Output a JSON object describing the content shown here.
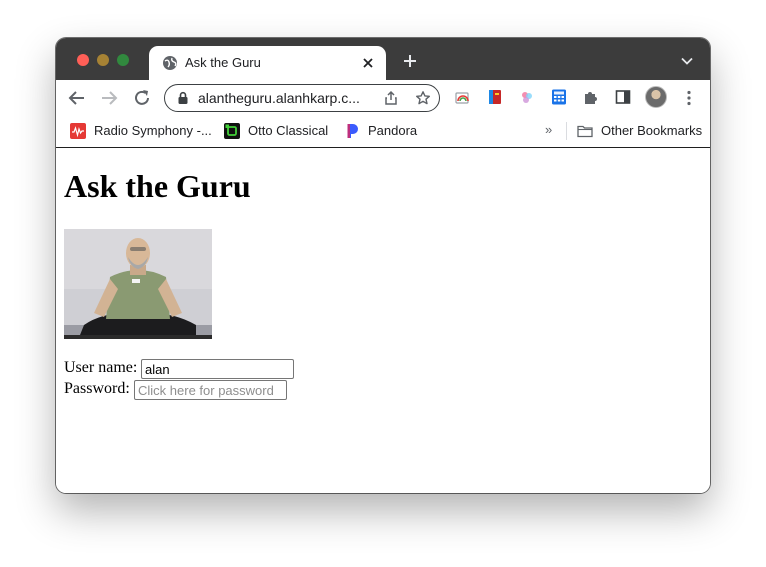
{
  "browser": {
    "tab": {
      "title": "Ask the Guru"
    },
    "address_bar": {
      "url": "alantheguru.alanhkarp.c..."
    },
    "bookmarks": [
      {
        "label": "Radio Symphony -...",
        "icon": "radio-wave-icon",
        "color": "#e53935"
      },
      {
        "label": "Otto Classical",
        "icon": "otto-icon",
        "color": "#43d13a"
      },
      {
        "label": "Pandora",
        "icon": "pandora-icon",
        "color": "#3b5bfd"
      }
    ],
    "other_bookmarks_label": "Other Bookmarks",
    "overflow_label": "»"
  },
  "page": {
    "heading": "Ask the Guru",
    "photo": {
      "icon": "guru-photo"
    },
    "username_label": "User name:",
    "username_value": "alan",
    "password_label": "Password:",
    "password_placeholder": "Click here for password"
  }
}
